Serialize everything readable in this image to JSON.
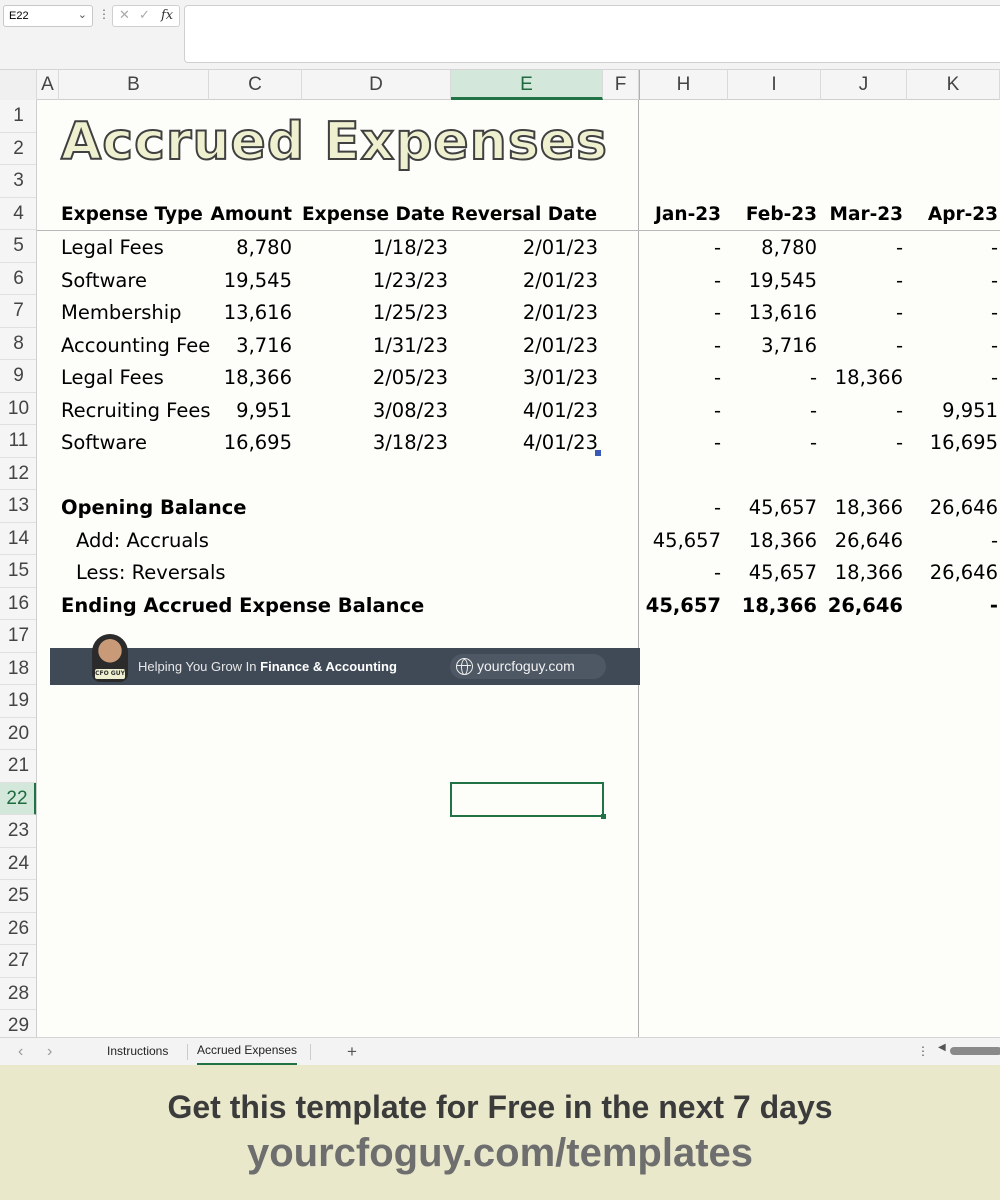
{
  "formula_bar": {
    "name_box": "E22",
    "cancel_icon": "✕",
    "confirm_icon": "✓",
    "fx_label": "fx",
    "formula": ""
  },
  "columns": [
    "A",
    "B",
    "C",
    "D",
    "E",
    "F",
    "H",
    "I",
    "J",
    "K"
  ],
  "selected_column": "E",
  "rows": [
    "1",
    "2",
    "3",
    "4",
    "5",
    "6",
    "7",
    "8",
    "9",
    "10",
    "11",
    "12",
    "13",
    "14",
    "15",
    "16",
    "17",
    "18",
    "19",
    "20",
    "21",
    "22",
    "23",
    "24",
    "25",
    "26",
    "27",
    "28",
    "29"
  ],
  "selected_row": "22",
  "sheet": {
    "title": "Accrued Expenses",
    "headers": {
      "expense_type": "Expense Type",
      "amount": "Amount",
      "expense_date": "Expense Date",
      "reversal_date": "Reversal Date",
      "months": [
        "Jan-23",
        "Feb-23",
        "Mar-23",
        "Apr-23"
      ]
    },
    "expenses": [
      {
        "type": "Legal Fees",
        "amount": "8,780",
        "expense_date": "1/18/23",
        "reversal_date": "2/01/23",
        "months": [
          "-",
          "8,780",
          "-",
          "-"
        ]
      },
      {
        "type": "Software",
        "amount": "19,545",
        "expense_date": "1/23/23",
        "reversal_date": "2/01/23",
        "months": [
          "-",
          "19,545",
          "-",
          "-"
        ]
      },
      {
        "type": "Membership",
        "amount": "13,616",
        "expense_date": "1/25/23",
        "reversal_date": "2/01/23",
        "months": [
          "-",
          "13,616",
          "-",
          "-"
        ]
      },
      {
        "type": "Accounting Fee",
        "amount": "3,716",
        "expense_date": "1/31/23",
        "reversal_date": "2/01/23",
        "months": [
          "-",
          "3,716",
          "-",
          "-"
        ]
      },
      {
        "type": "Legal Fees",
        "amount": "18,366",
        "expense_date": "2/05/23",
        "reversal_date": "3/01/23",
        "months": [
          "-",
          "-",
          "18,366",
          "-"
        ]
      },
      {
        "type": "Recruiting Fees",
        "amount": "9,951",
        "expense_date": "3/08/23",
        "reversal_date": "4/01/23",
        "months": [
          "-",
          "-",
          "-",
          "9,951"
        ]
      },
      {
        "type": "Software",
        "amount": "16,695",
        "expense_date": "3/18/23",
        "reversal_date": "4/01/23",
        "months": [
          "-",
          "-",
          "-",
          "16,695"
        ]
      }
    ],
    "summary": [
      {
        "label": "Opening Balance",
        "style": "bold",
        "months": [
          "-",
          "45,657",
          "18,366",
          "26,646"
        ]
      },
      {
        "label": "Add: Accruals",
        "style": "indent",
        "months": [
          "45,657",
          "18,366",
          "26,646",
          "-"
        ]
      },
      {
        "label": "Less: Reversals",
        "style": "indent",
        "months": [
          "-",
          "45,657",
          "18,366",
          "26,646"
        ]
      },
      {
        "label": "Ending Accrued Expense Balance",
        "style": "bold",
        "months": [
          "45,657",
          "18,366",
          "26,646",
          "-"
        ]
      }
    ]
  },
  "banner": {
    "badge": "CFO GUY",
    "tagline_prefix": "Helping You Grow In ",
    "tagline_bold": "Finance & Accounting",
    "url": "yourcfoguy.com"
  },
  "tabs": {
    "prev_icon": "‹",
    "next_icon": "›",
    "items": [
      "Instructions",
      "Accrued Expenses"
    ],
    "active": "Accrued Expenses",
    "add_icon": "+",
    "more_icon": "⋮"
  },
  "promo": {
    "line1": "Get this template for Free in the next 7 days",
    "line2": "yourcfoguy.com/templates"
  },
  "colors": {
    "excel_green": "#217346",
    "title_fill": "#eef0cf",
    "banner_bg": "#3f4a56",
    "promo_bg": "#e9e8cb"
  }
}
